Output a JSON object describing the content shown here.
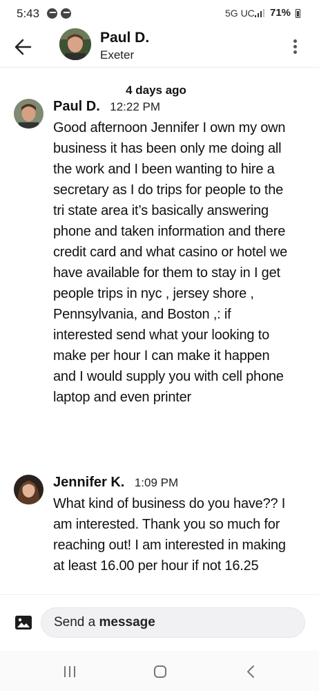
{
  "status_bar": {
    "time": "5:43",
    "network": "5G UC",
    "battery": "71%"
  },
  "header": {
    "name": "Paul D.",
    "location": "Exeter"
  },
  "conversation": {
    "day_separator": "4 days ago",
    "messages": [
      {
        "sender": "Paul D.",
        "time": "12:22 PM",
        "text": "Good afternoon Jennifer I own my own business it has been only me doing all the work and I been wanting to hire a secretary as I do trips for people to the tri state area it’s basically answering phone and taken information and there credit card and what casino or hotel we have available for them to stay in I get people trips in nyc , jersey shore , Pennsylvania, and Boston ,: if interested send what your looking to make per hour I can make it happen and I would supply you with cell phone laptop and even printer"
      },
      {
        "sender": "Jennifer K.",
        "time": "1:09 PM",
        "text": "What kind of business do you have?? I am interested. Thank you so much for reaching out! I am interested in making at least 16.00 per hour if not 16.25"
      }
    ]
  },
  "composer": {
    "placeholder_prefix": "Send a ",
    "placeholder_bold": "message"
  },
  "colors": {
    "background": "#ffffff",
    "input_bg": "#f1f1f3",
    "text": "#111111"
  },
  "icons": [
    "back-arrow-icon",
    "more-options-icon",
    "image-icon",
    "recent-apps-icon",
    "home-icon",
    "nav-back-icon"
  ]
}
